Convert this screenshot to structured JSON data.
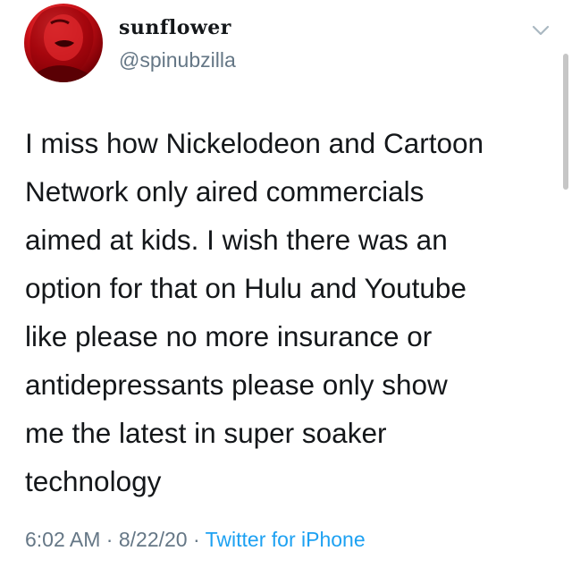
{
  "author": {
    "display_name": "sunflower",
    "handle": "@spinubzilla"
  },
  "menu_icon": "chevron-down-icon",
  "tweet": {
    "lines": [
      "I miss how Nickelodeon and Cartoon",
      "Network only aired commercials",
      "aimed at kids. I wish there was an",
      "option for that on Hulu and Youtube",
      "like please no more insurance or",
      "antidepressants please only show",
      "me the latest in super soaker",
      "technology"
    ]
  },
  "meta": {
    "time": "6:02 AM",
    "separator": "·",
    "date": "8/22/20",
    "source": "Twitter for iPhone"
  },
  "colors": {
    "text": "#14171a",
    "secondary": "#657786",
    "link": "#1da1f2",
    "avatar_red": "#c80f16"
  }
}
